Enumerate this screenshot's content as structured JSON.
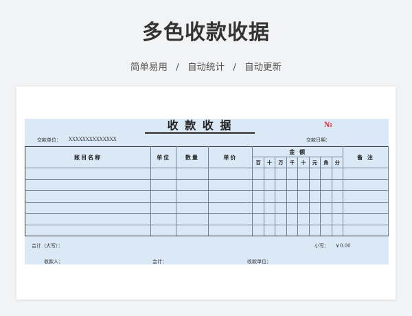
{
  "header": {
    "title": "多色收款收据",
    "features": [
      "简单易用",
      "自动统计",
      "自动更新"
    ],
    "separator": "/"
  },
  "receipt": {
    "title": "收 款 收 据",
    "number_label": "№",
    "payer_label": "交款单位：",
    "payer_value": "XXXXXXXXXXXXXX",
    "date_label": "交款日期：",
    "columns": {
      "item": "账目名称",
      "unit": "单位",
      "qty": "数量",
      "price": "单价",
      "amount": "金  额",
      "remark": "备  注"
    },
    "digits": [
      "百",
      "十",
      "万",
      "千",
      "十",
      "元",
      "角",
      "分"
    ],
    "empty_rows": 6,
    "total_label": "合计（大写）：",
    "small_label": "小写：",
    "small_value": "￥0.00",
    "payee_label": "收款人：",
    "accountant_label": "会计：",
    "payee_unit_label": "收款单位："
  },
  "colors": {
    "receipt_bg": "#dbe8f5",
    "number_red": "#e0303c"
  }
}
